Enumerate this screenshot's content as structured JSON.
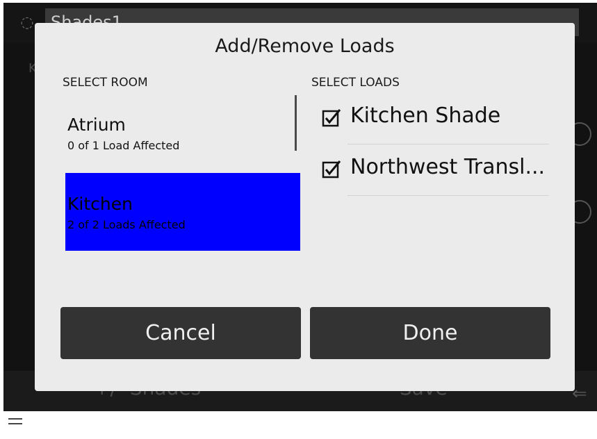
{
  "app": {
    "title": "Shades1",
    "bg_label": "K",
    "bottom_left_label": "+/- Shades",
    "bottom_right_label": "Save"
  },
  "dialog": {
    "title": "Add/Remove Loads",
    "select_room_label": "SELECT ROOM",
    "select_loads_label": "SELECT LOADS",
    "rooms": [
      {
        "name": "Atrium",
        "count": "0 of 1 Load Affected",
        "selected": false
      },
      {
        "name": "Kitchen",
        "count": "2 of 2 Loads Affected",
        "selected": true
      }
    ],
    "loads": [
      {
        "name": "Kitchen Shade",
        "checked": true
      },
      {
        "name": "Northwest Transl...",
        "checked": true
      }
    ],
    "cancel_label": "Cancel",
    "done_label": "Done"
  },
  "colors": {
    "selected_room": "#0000ff",
    "button_bg": "#333333",
    "dialog_bg": "#ebebeb"
  },
  "icons": [
    "app-logo-icon",
    "checkbox-checked-icon",
    "back-arrow-icon",
    "menu-icon"
  ]
}
